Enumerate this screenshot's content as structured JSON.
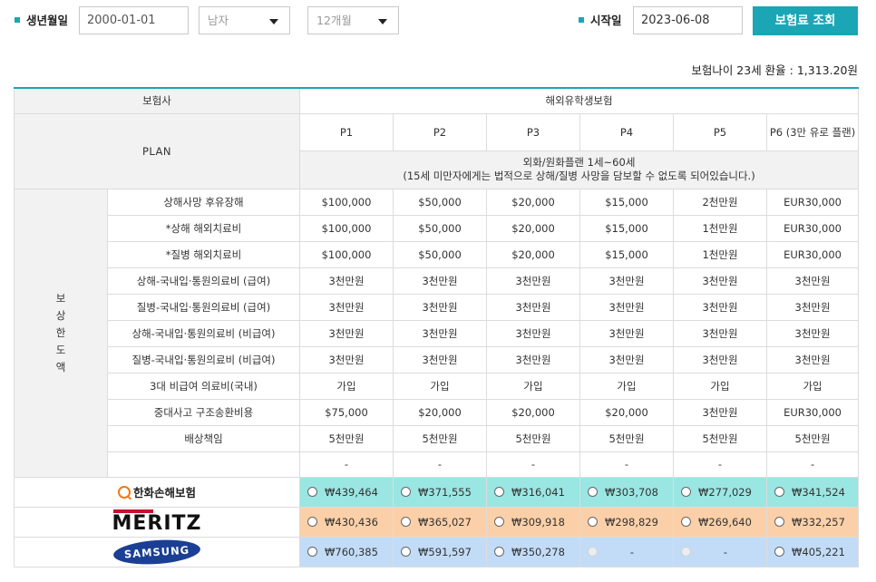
{
  "form": {
    "birth_label": "생년월일",
    "birth_value": "2000-01-01",
    "gender_value": "남자",
    "period_value": "12개월",
    "start_label": "시작일",
    "start_value": "2023-06-08",
    "query_button": "보험료 조회"
  },
  "age_rate_text": "보험나이 23세 환율 : 1,313.20원",
  "table": {
    "insurer_header": "보험사",
    "product_header": "해외유학생보험",
    "plan_label": "PLAN",
    "plans": [
      "P1",
      "P2",
      "P3",
      "P4",
      "P5",
      "P6\n(3만 유로 플랜)"
    ],
    "plan_desc_line1": "외화/원화플랜 1세~60세",
    "plan_desc_line2": "(15세 미만자에게는 법적으로 상해/질병 사망을 담보할 수 없도록 되어있습니다.)",
    "coverage_label": [
      "보",
      "상",
      "한",
      "도",
      "액"
    ],
    "rows": [
      {
        "name": "상해사망 후유장해",
        "values": [
          "$100,000",
          "$50,000",
          "$20,000",
          "$15,000",
          "2천만원",
          "EUR30,000"
        ]
      },
      {
        "name": "*상해 해외치료비",
        "values": [
          "$100,000",
          "$50,000",
          "$20,000",
          "$15,000",
          "1천만원",
          "EUR30,000"
        ]
      },
      {
        "name": "*질병 해외치료비",
        "values": [
          "$100,000",
          "$50,000",
          "$20,000",
          "$15,000",
          "1천만원",
          "EUR30,000"
        ]
      },
      {
        "name": "상해-국내입·통원의료비 (급여)",
        "values": [
          "3천만원",
          "3천만원",
          "3천만원",
          "3천만원",
          "3천만원",
          "3천만원"
        ]
      },
      {
        "name": "질병-국내입·통원의료비 (급여)",
        "values": [
          "3천만원",
          "3천만원",
          "3천만원",
          "3천만원",
          "3천만원",
          "3천만원"
        ]
      },
      {
        "name": "상해-국내입·통원의료비 (비급여)",
        "values": [
          "3천만원",
          "3천만원",
          "3천만원",
          "3천만원",
          "3천만원",
          "3천만원"
        ]
      },
      {
        "name": "질병-국내입·통원의료비 (비급여)",
        "values": [
          "3천만원",
          "3천만원",
          "3천만원",
          "3천만원",
          "3천만원",
          "3천만원"
        ]
      },
      {
        "name": "3대 비급여 의료비(국내)",
        "values": [
          "가입",
          "가입",
          "가입",
          "가입",
          "가입",
          "가입"
        ]
      },
      {
        "name": "중대사고 구조송환비용",
        "values": [
          "$75,000",
          "$20,000",
          "$20,000",
          "$20,000",
          "3천만원",
          "EUR30,000"
        ]
      },
      {
        "name": "배상책임",
        "values": [
          "5천만원",
          "5천만원",
          "5천만원",
          "5천만원",
          "5천만원",
          "5천만원"
        ]
      },
      {
        "name": "",
        "values": [
          "-",
          "-",
          "-",
          "-",
          "-",
          "-"
        ]
      }
    ],
    "insurers": [
      {
        "name": "한화손해보험",
        "color": "#9ae6e2",
        "prices": [
          "₩439,464",
          "₩371,555",
          "₩316,041",
          "₩303,708",
          "₩277,029",
          "₩341,524"
        ]
      },
      {
        "name": "MERITZ",
        "color": "#fbd0a8",
        "prices": [
          "₩430,436",
          "₩365,027",
          "₩309,918",
          "₩298,829",
          "₩269,640",
          "₩332,257"
        ]
      },
      {
        "name": "SAMSUNG",
        "color": "#c2dcf7",
        "prices": [
          "₩760,385",
          "₩591,597",
          "₩350,278",
          "-",
          "-",
          "₩405,221"
        ]
      }
    ]
  }
}
